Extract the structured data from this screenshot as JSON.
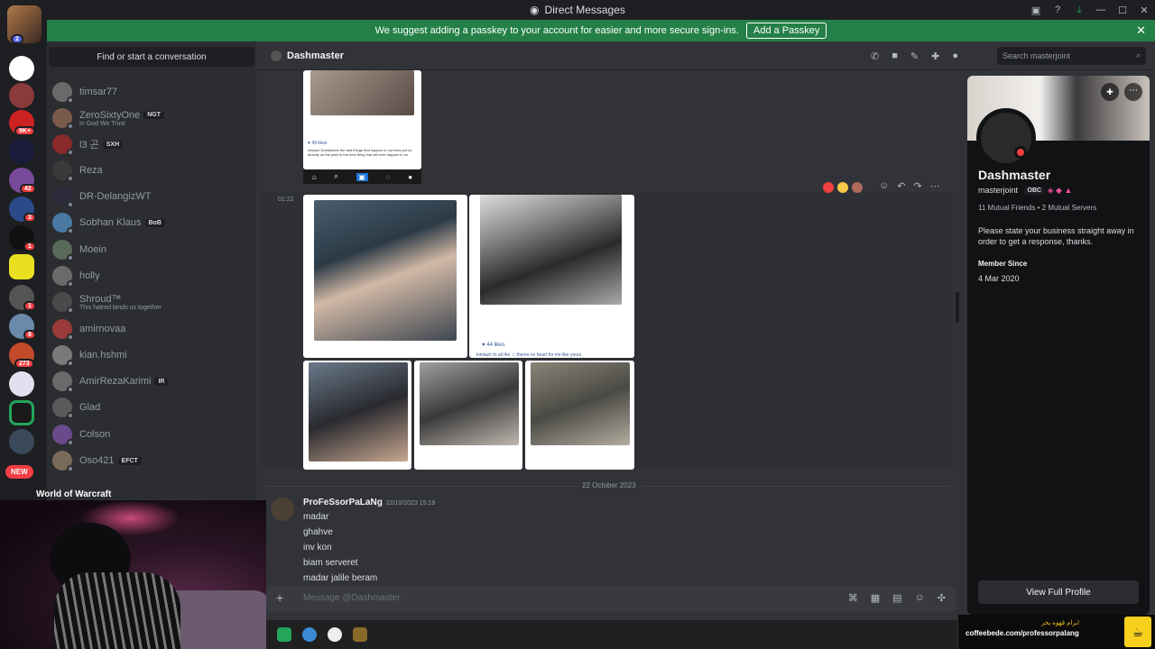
{
  "window": {
    "title": "Direct Messages",
    "controls": [
      "▣",
      "?",
      "⤓",
      "—",
      "☐",
      "✕"
    ]
  },
  "banner": {
    "text": "We suggest adding a passkey to your account for easier and more secure sign-ins.",
    "button": "Add a Passkey",
    "close": "✕"
  },
  "rail": {
    "avatar_badge": "2",
    "badges": [
      "9K+",
      "42",
      "3",
      "1",
      "1",
      "8",
      "273"
    ],
    "new_label": "NEW"
  },
  "dmlist": {
    "search": "Find or start a conversation",
    "items": [
      {
        "name": "timsar77",
        "sub": "",
        "tag": ""
      },
      {
        "name": "ZeroSixtyOne",
        "sub": "In God We Trust",
        "tag": "NGT"
      },
      {
        "name": "l3 곤",
        "sub": "",
        "tag": "SXH"
      },
      {
        "name": "Reza",
        "sub": "",
        "tag": ""
      },
      {
        "name": "DR-DelangizWT",
        "sub": "",
        "tag": ""
      },
      {
        "name": "Sobhan Klaus",
        "sub": "",
        "tag": "BoB"
      },
      {
        "name": "Moein",
        "sub": "",
        "tag": ""
      },
      {
        "name": "holly",
        "sub": "",
        "tag": ""
      },
      {
        "name": "Shroud™",
        "sub": "This hatred binds us together",
        "tag": ""
      },
      {
        "name": "amirnovaa",
        "sub": "",
        "tag": ""
      },
      {
        "name": "kian.hshmi",
        "sub": "",
        "tag": ""
      },
      {
        "name": "AmirRezaKarimi",
        "sub": "",
        "tag": "IR"
      },
      {
        "name": "Glad",
        "sub": "",
        "tag": ""
      },
      {
        "name": "Colson",
        "sub": "",
        "tag": ""
      },
      {
        "name": "Oso421",
        "sub": "",
        "tag": "EFCT"
      }
    ],
    "activity": "World of Warcraft"
  },
  "header": {
    "name": "Dashmaster",
    "search": "Search masterjoint",
    "icons": [
      "phone-icon",
      "video-icon",
      "pin-icon",
      "add-friend-icon",
      "profile-icon"
    ]
  },
  "chat": {
    "timestamp": "01:22",
    "post_likes_1": "♥ 49 likes",
    "post_likes_2": "♥ 44 likes",
    "post_caption": "kimiazh Sometimes the bad things that happen in our lives put us directly on the path to the best thing that will ever happen to us",
    "post_caption_2": "kimiazh In all the ☆ theres no heart for me like yours",
    "date_divider": "22 October 2023",
    "message": {
      "author": "ProFeSsorPaLaNg",
      "time": "22/10/2023 15:19",
      "lines": [
        "madar",
        "ghahve",
        "inv kon",
        "biam serveret",
        "madar jalile beram"
      ]
    }
  },
  "composer": {
    "placeholder": "Message @Dashmaster"
  },
  "profile": {
    "name": "Dashmaster",
    "username": "masterjoint",
    "tag": "OBC",
    "mutual": "11 Mutual Friends • 2 Mutual Servers",
    "bio": "Please state your business straight away in order to get a response, thanks.",
    "member_since_label": "Member Since",
    "member_since": "4 Mar 2020",
    "view_button": "View Full Profile"
  },
  "overlay": {
    "farsi": "برام قهوه بخر!",
    "url": "coffeebede.com/professorpalang"
  }
}
